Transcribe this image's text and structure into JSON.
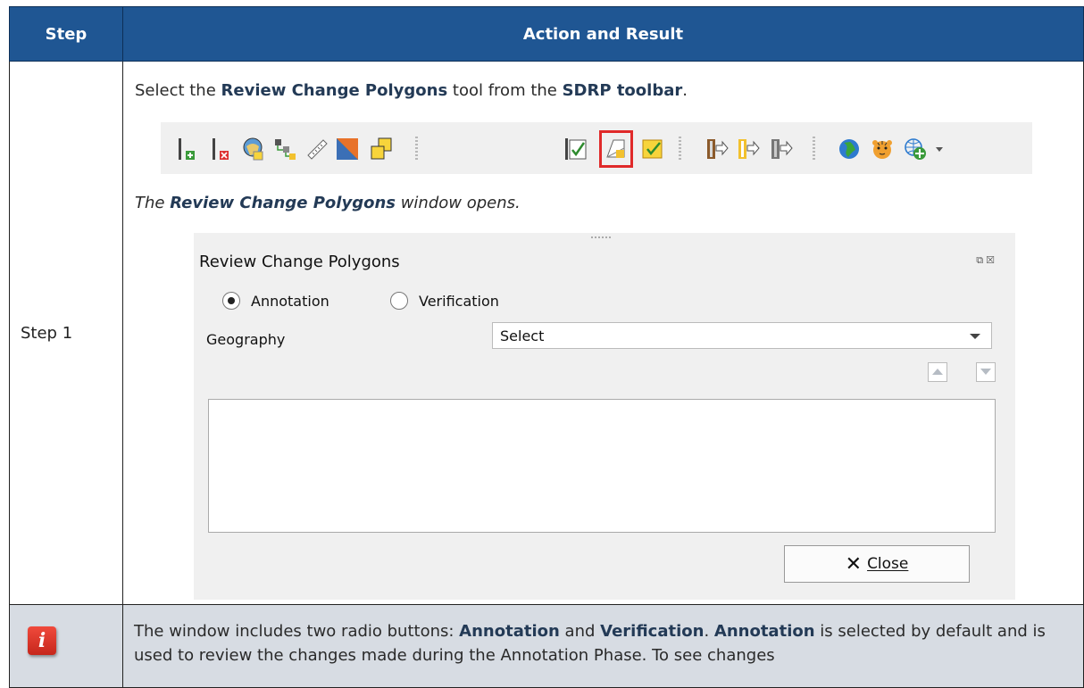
{
  "table": {
    "header_step": "Step",
    "header_action": "Action and Result",
    "step_label": "Step 1"
  },
  "instruction": {
    "prefix": "Select the ",
    "tool_name": "Review Change Polygons",
    "middle": " tool from the ",
    "toolbar_name": "SDRP toolbar",
    "suffix": "."
  },
  "result": {
    "prefix": "The ",
    "window_name": "Review Change Polygons",
    "suffix": " window opens."
  },
  "toolbar": {
    "icons": [
      "add-line-icon",
      "delete-line-icon",
      "map-tool-icon",
      "tree-icon",
      "measure-icon",
      "polygon-icon",
      "copy-icon",
      "verify-check-icon",
      "review-change-polygons-icon",
      "checklist-icon",
      "export-icon",
      "export-2-icon",
      "export-3-icon",
      "globe-icon",
      "tiger-icon",
      "add-web-service-icon"
    ],
    "highlighted": "review-change-polygons-icon"
  },
  "dialog": {
    "title": "Review Change Polygons",
    "radio_annotation": "Annotation",
    "radio_verification": "Verification",
    "selected_radio": "Annotation",
    "geography_label": "Geography",
    "geography_value": "Select",
    "close_label": "Close"
  },
  "note": {
    "text_1": "The window includes two radio buttons: ",
    "bold_1": "Annotation",
    "text_2": " and ",
    "bold_2": "Verification",
    "text_3": ". ",
    "bold_3": "Annotation",
    "text_4": " is selected by default and is used to review the changes made during the Annotation Phase. To see changes"
  },
  "colors": {
    "header_bg": "#1f5693",
    "note_bg": "#d7dce3",
    "highlight": "#e02a2a"
  }
}
